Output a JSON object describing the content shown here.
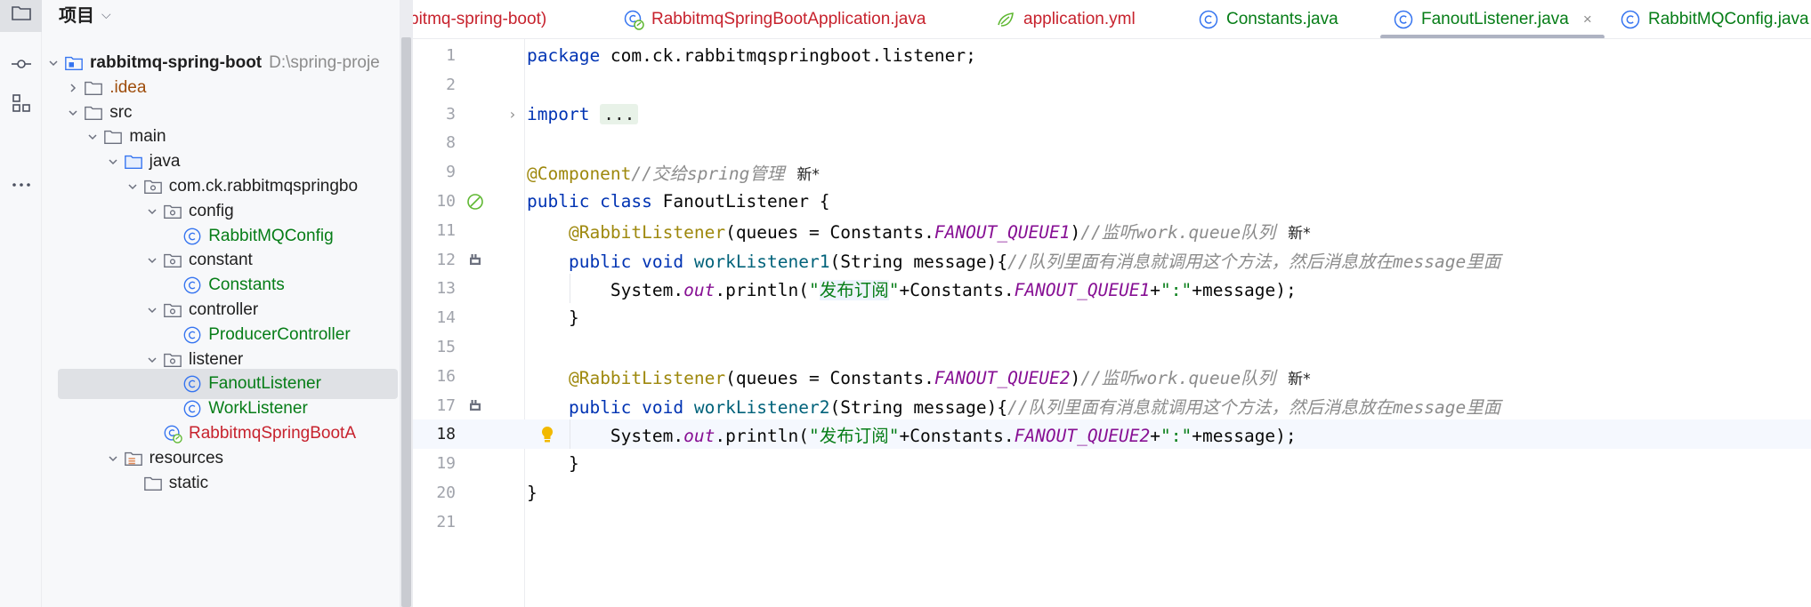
{
  "sidebar": {
    "header": "项目",
    "activity_icons": [
      "folder-icon",
      "commit-icon",
      "structure-icon",
      "more-icon"
    ]
  },
  "tree": [
    {
      "label": "rabbitmq-spring-boot",
      "path": "D:\\spring-proje",
      "indent": 0,
      "expanded": true,
      "icon": "module-folder-icon",
      "style": "bold"
    },
    {
      "label": ".idea",
      "indent": 1,
      "expanded": false,
      "icon": "folder-icon",
      "style": "orange"
    },
    {
      "label": "src",
      "indent": 1,
      "expanded": true,
      "icon": "folder-icon",
      "style": "normal"
    },
    {
      "label": "main",
      "indent": 2,
      "expanded": true,
      "icon": "folder-icon",
      "style": "normal"
    },
    {
      "label": "java",
      "indent": 3,
      "expanded": true,
      "icon": "source-folder-icon",
      "style": "normal"
    },
    {
      "label": "com.ck.rabbitmqspringbo",
      "indent": 4,
      "expanded": true,
      "icon": "package-icon",
      "style": "normal"
    },
    {
      "label": "config",
      "indent": 5,
      "expanded": true,
      "icon": "package-icon",
      "style": "normal"
    },
    {
      "label": "RabbitMQConfig",
      "indent": 6,
      "icon": "class-icon",
      "style": "green"
    },
    {
      "label": "constant",
      "indent": 5,
      "expanded": true,
      "icon": "package-icon",
      "style": "normal"
    },
    {
      "label": "Constants",
      "indent": 6,
      "icon": "class-icon",
      "style": "green"
    },
    {
      "label": "controller",
      "indent": 5,
      "expanded": true,
      "icon": "package-icon",
      "style": "normal"
    },
    {
      "label": "ProducerController",
      "indent": 6,
      "icon": "class-icon",
      "style": "green"
    },
    {
      "label": "listener",
      "indent": 5,
      "expanded": true,
      "icon": "package-icon",
      "style": "normal"
    },
    {
      "label": "FanoutListener",
      "indent": 6,
      "icon": "class-icon",
      "style": "green",
      "selected": true
    },
    {
      "label": "WorkListener",
      "indent": 6,
      "icon": "class-icon",
      "style": "green"
    },
    {
      "label": "RabbitmqSpringBootA",
      "indent": 5,
      "icon": "spring-boot-class-icon",
      "style": "red"
    },
    {
      "label": "resources",
      "indent": 3,
      "expanded": true,
      "icon": "resources-folder-icon",
      "style": "normal"
    },
    {
      "label": "static",
      "indent": 4,
      "icon": "folder-icon",
      "style": "normal"
    }
  ],
  "tabs": [
    {
      "label": "bitmq-spring-boot)",
      "style": "red",
      "icon": ""
    },
    {
      "label": "RabbitmqSpringBootApplication.java",
      "style": "red",
      "icon": "spring-boot-class-icon"
    },
    {
      "label": "application.yml",
      "style": "red",
      "icon": "spring-yml-icon"
    },
    {
      "label": "Constants.java",
      "style": "green",
      "icon": "class-icon"
    },
    {
      "label": "FanoutListener.java",
      "style": "green",
      "icon": "class-icon",
      "active": true,
      "close": "×"
    },
    {
      "label": "RabbitMQConfig.java",
      "style": "green",
      "icon": "class-icon"
    }
  ],
  "editor": {
    "current_line": 18,
    "lines": [
      {
        "n": "1"
      },
      {
        "n": "2"
      },
      {
        "n": "3"
      },
      {
        "n": "8"
      },
      {
        "n": "9"
      },
      {
        "n": "10"
      },
      {
        "n": "11"
      },
      {
        "n": "12"
      },
      {
        "n": "13"
      },
      {
        "n": "14"
      },
      {
        "n": "15"
      },
      {
        "n": "16"
      },
      {
        "n": "17"
      },
      {
        "n": "18"
      },
      {
        "n": "19"
      },
      {
        "n": "20"
      },
      {
        "n": "21"
      }
    ],
    "code": {
      "l1_kw": "package",
      "l1_rest": " com.ck.rabbitmqspringboot.listener;",
      "l3_kw": "import",
      "l3_fold": "...",
      "l9_ann": "@Component",
      "l9_cmt": "//交给spring管理",
      "l9_new": "新*",
      "l10_kw": "public class",
      "l10_rest": " FanoutListener {",
      "l11_ann": "@RabbitListener",
      "l11_a": "(queues = Constants.",
      "l11_const": "FANOUT_QUEUE1",
      "l11_b": ")",
      "l11_cmt": "//监听work.queue队列",
      "l11_new": "新*",
      "l12_kw": "public void",
      "l12_method": "workListener1",
      "l12_rest": "(String message){",
      "l12_cmt": "//队列里面有消息就调用这个方法，然后消息放在message里面",
      "l13_a": "System.",
      "l13_out": "out",
      "l13_b": ".println(",
      "l13_str1": "\"",
      "l13_strhl": "发布订阅",
      "l13_str2": "\"",
      "l13_c": "+Constants.",
      "l13_const": "FANOUT_QUEUE1",
      "l13_d": "+",
      "l13_str3": "\":\"",
      "l13_e": "+message);",
      "l14": "}",
      "l16_ann": "@RabbitListener",
      "l16_a": "(queues = Constants.",
      "l16_const": "FANOUT_QUEUE2",
      "l16_b": ")",
      "l16_cmt": "//监听work.queue队列",
      "l16_new": "新*",
      "l17_kw": "public void",
      "l17_method": "workListener2",
      "l17_rest": "(String message){",
      "l17_cmt": "//队列里面有消息就调用这个方法，然后消息放在message里面",
      "l18_a": "System.",
      "l18_out": "out",
      "l18_b": ".println(",
      "l18_str1": "\"发布订阅\"",
      "l18_c": "+Constants.",
      "l18_const": "FANOUT_QUEUE2",
      "l18_d": "+",
      "l18_str3": "\":\"",
      "l18_e": "+message);",
      "l19": "}",
      "l20": "}"
    }
  },
  "colors": {
    "keyword": "#0033b3",
    "annotation": "#9e880d",
    "string": "#067d17",
    "comment": "#8c8c8c",
    "constant": "#871094",
    "method": "#00627a",
    "modified_file": "#c7222d",
    "tracked_file": "#067d17"
  }
}
